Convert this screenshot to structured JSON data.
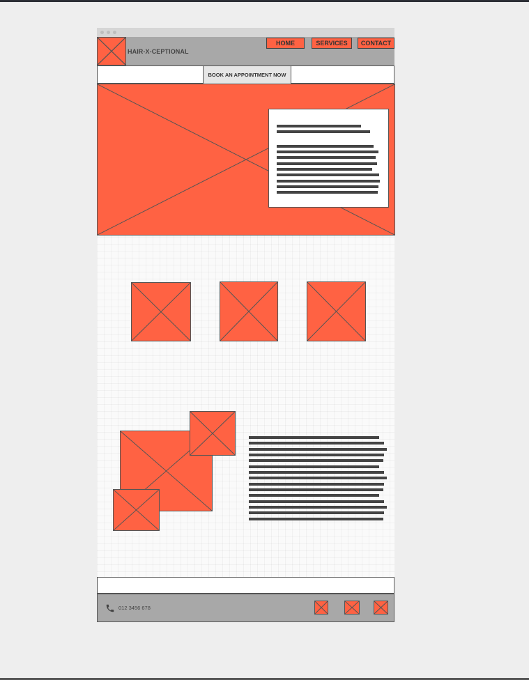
{
  "header": {
    "logo_text": "HAIR-X-CEPTIONAL",
    "nav": [
      {
        "label": "HOME"
      },
      {
        "label": "SERVICES"
      },
      {
        "label": "CONTACT"
      }
    ]
  },
  "booking": {
    "button_label": "BOOK AN APPOINTMENT NOW"
  },
  "footer": {
    "phone": "012 3456 678",
    "phone_icon": "phone-icon",
    "social_icons": [
      "social-icon-1",
      "social-icon-2",
      "social-icon-3"
    ]
  },
  "colors": {
    "accent": "#ff6243",
    "header_bg": "#a8a8a8",
    "text_line": "#444444",
    "page_bg": "#eeeeee"
  }
}
